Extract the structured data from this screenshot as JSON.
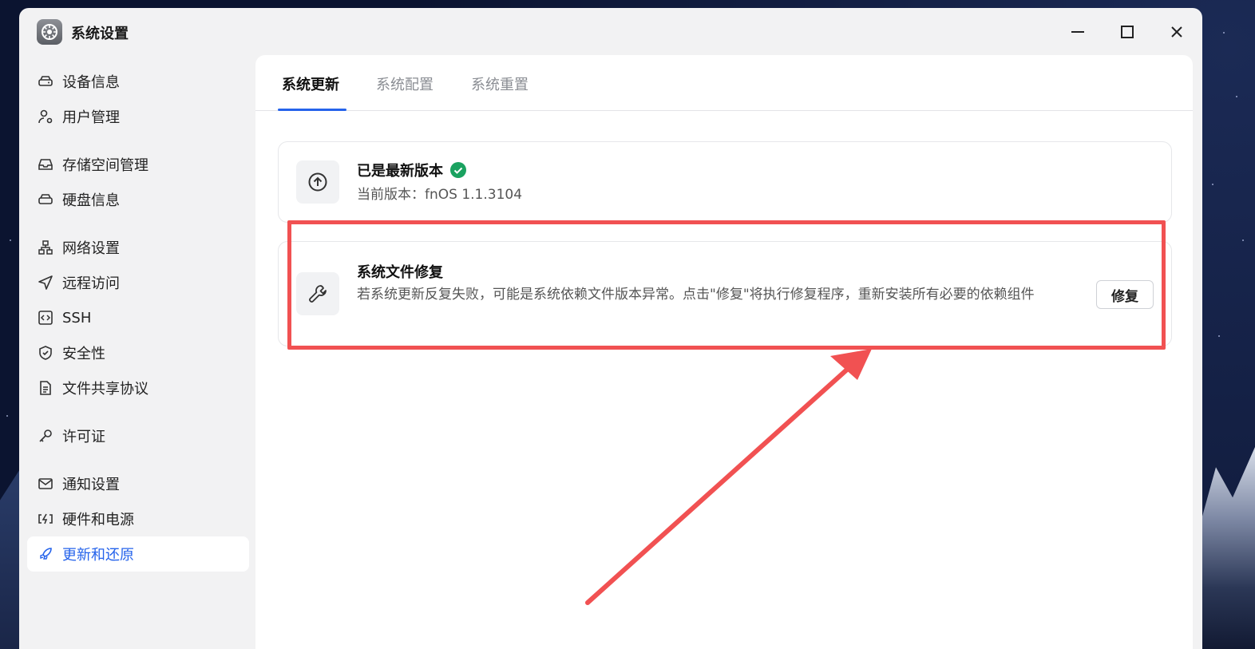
{
  "window": {
    "title": "系统设置",
    "app_icon": "gear-icon"
  },
  "sidebar": {
    "items": [
      {
        "label": "设备信息",
        "icon": "drive-icon"
      },
      {
        "label": "用户管理",
        "icon": "user-gear-icon"
      },
      {
        "label": "存储空间管理",
        "icon": "inbox-tray-icon"
      },
      {
        "label": "硬盘信息",
        "icon": "hard-disk-icon"
      },
      {
        "label": "网络设置",
        "icon": "network-icon"
      },
      {
        "label": "远程访问",
        "icon": "send-icon"
      },
      {
        "label": "SSH",
        "icon": "code-bracket-icon"
      },
      {
        "label": "安全性",
        "icon": "shield-check-icon"
      },
      {
        "label": "文件共享协议",
        "icon": "document-icon"
      },
      {
        "label": "许可证",
        "icon": "key-icon"
      },
      {
        "label": "通知设置",
        "icon": "mail-icon"
      },
      {
        "label": "硬件和电源",
        "icon": "power-bolt-icon"
      },
      {
        "label": "更新和还原",
        "icon": "rocket-icon"
      }
    ],
    "active_index": 12
  },
  "tabs": [
    {
      "label": "系统更新"
    },
    {
      "label": "系统配置"
    },
    {
      "label": "系统重置"
    }
  ],
  "update_card": {
    "title": "已是最新版本",
    "version_text": "当前版本：fnOS 1.1.3104",
    "icon": "arrow-up-circle-icon",
    "status_icon": "check-circle-icon"
  },
  "repair_card": {
    "title": "系统文件修复",
    "description": "若系统更新反复失败，可能是系统依赖文件版本异常。点击\"修复\"将执行修复程序，重新安装所有必要的依赖组件",
    "button_label": "修复",
    "icon": "wrench-icon"
  },
  "colors": {
    "accent": "#2563eb",
    "success": "#1aa260",
    "annotation": "#f15152"
  }
}
